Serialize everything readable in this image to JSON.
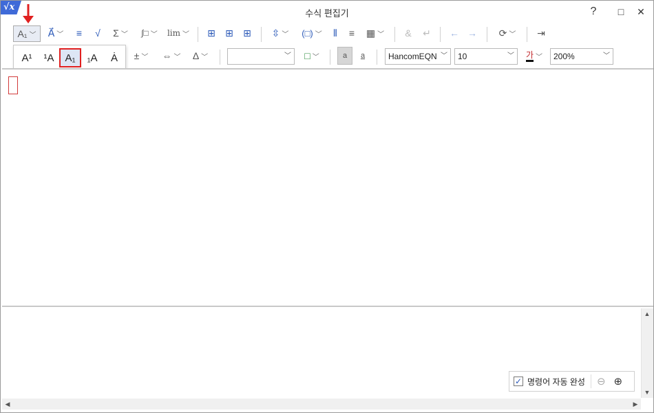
{
  "window": {
    "app_icon": "√x",
    "title": "수식 편집기",
    "help": "?",
    "maximize": "□",
    "close": "✕"
  },
  "toolbar1": {
    "script_type": "A₁",
    "overline_icon": "A⃗",
    "fraction_icon": "≡",
    "root_icon": "√",
    "sum": "Σ",
    "integral": "∫□",
    "lim": "lim",
    "matrix1": "⊞",
    "matrix2": "⊞",
    "matrix3": "⊞",
    "bracket_pos": "⇳",
    "paren": "(□)",
    "matrix_grid": "⦀",
    "lines": "≡",
    "grid": "▦",
    "ampersand": "&",
    "enter": "↵",
    "undo": "←",
    "redo": "→",
    "convert": "⟳",
    "exit": "⇥"
  },
  "dropdown": {
    "items": [
      "A¹",
      "¹A",
      "A₁",
      "₁A",
      "Ȧ"
    ],
    "selected_index": 2
  },
  "toolbar2": {
    "plusminus": "±",
    "arrows": "⇔",
    "delta": "Δ",
    "style_combo": "",
    "color_fill": "□",
    "text_ab1": "a",
    "text_ab2": "a",
    "font": "HancomEQN",
    "size": "10",
    "font_color_glyph": "가",
    "zoom": "200%"
  },
  "autocomplete": {
    "label": "명령어 자동 완성",
    "checked": true,
    "zoom_out": "⊖",
    "zoom_in": "⊕"
  },
  "colors": {
    "accent": "#2a58b8",
    "highlight_red": "#e02020",
    "app_blue": "#3f6ad8"
  }
}
